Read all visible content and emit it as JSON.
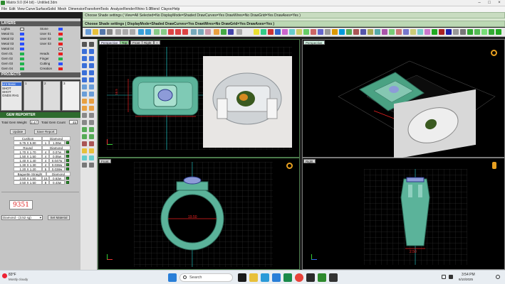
{
  "window": {
    "title": "Matrix 9.0 (64 bit) - Untitled.3dm"
  },
  "menu": [
    "File",
    "Edit",
    "View",
    "Curve",
    "Surface",
    "Solid",
    "Mesh",
    "Dimension",
    "Transform",
    "Tools",
    "Analyze",
    "Render",
    "Rhino 5.0",
    "Blend",
    "Clayoo",
    "Help"
  ],
  "command": {
    "line1": "Choose Shade settings ( View=All  Selected=No  DisplayMode=Shaded  DrawCurves=Yes  DrawWires=No  DrawGrid=Yes  DrawAxes=Yes )",
    "line2": "Choose Shade settings ( DisplayMode=Shaded  DrawCurves=Yes  DrawWires=No  DrawGrid=Yes  DrawAxes=Yes )"
  },
  "layers": {
    "header": "LAYERS",
    "rows": [
      {
        "name": "Lights",
        "color": "#ffffff"
      },
      {
        "name": "Metal 01",
        "color": "#2b4fff"
      },
      {
        "name": "Metal 02",
        "color": "#2b4fff"
      },
      {
        "name": "Metal 03",
        "color": "#2b4fff"
      },
      {
        "name": "Metal 04",
        "color": "#2b4fff"
      },
      {
        "name": "Gem 01",
        "color": "#21b34c"
      },
      {
        "name": "Gem 02",
        "color": "#21b34c"
      },
      {
        "name": "Gem 03",
        "color": "#21b34c"
      },
      {
        "name": "Gem 04",
        "color": "#21b34c"
      }
    ],
    "rows_right": [
      {
        "name": "Stone",
        "color": "#2b4fff"
      },
      {
        "name": "User 01",
        "color": "#e81f1f"
      },
      {
        "name": "User 02",
        "color": "#21b34c"
      },
      {
        "name": "User 03",
        "color": "#e81f1f"
      },
      {
        "name": "",
        "color": "#ffffff"
      },
      {
        "name": "Heads",
        "color": "#e81f1f"
      },
      {
        "name": "Finger",
        "color": "#21b34c"
      },
      {
        "name": "Cutting",
        "color": "#2b4fff"
      },
      {
        "name": "Creation",
        "color": "#e81f1f"
      }
    ]
  },
  "projects": {
    "header": "PROJECTS",
    "items": [
      "Unt Basic",
      "SHOT",
      "SHOT",
      "GNDS RH1"
    ],
    "cells": [
      "1",
      "2",
      "3",
      "4"
    ]
  },
  "gem_reporter": {
    "title": "GEM REPORTER",
    "total_weight_label": "Total Gem Weight",
    "total_weight_value": "2.47",
    "total_count_label": "Total Gem Count",
    "total_count_value": "45",
    "update_button": "Update",
    "save_report_button": "Save Report",
    "sections": [
      {
        "shape": "Cushion",
        "material": "Diamond",
        "rows": [
          {
            "size": "6.75 X 5.80",
            "qty": "1",
            "weight": "1.08w"
          }
        ]
      },
      {
        "shape": "Round",
        "material": "Diamond",
        "rows": [
          {
            "size": "1.70 X 1.70",
            "qty": "4",
            "weight": "0.07w"
          },
          {
            "size": "1.50 X 1.50",
            "qty": "4",
            "weight": "0.05w"
          },
          {
            "size": "1.40 X 1.40",
            "qty": "4",
            "weight": "0.047w"
          },
          {
            "size": "1.30 X 1.30",
            "qty": "4",
            "weight": "0.036w"
          },
          {
            "size": "1.20 X 1.20",
            "qty": "5",
            "weight": "0.038w"
          }
        ]
      },
      {
        "shape": "Baguette Straight",
        "material": "Diamond",
        "rows": [
          {
            "size": "2.50 X 1.50",
            "qty": "15",
            "weight": "0.63w"
          },
          {
            "size": "2.50 X 1.50",
            "qty": "8",
            "weight": "0.43w"
          }
        ]
      }
    ],
    "big_number": "9351",
    "material_select": "Diamond - (3.52 sg)",
    "set_material_button": "Set Material"
  },
  "viewports": {
    "top": {
      "tabs": [
        "Perspective",
        "Top",
        "Front",
        "Right"
      ],
      "active": "Top"
    },
    "perspective": {
      "label": "Perspective"
    },
    "front": {
      "label": "Front"
    },
    "right": {
      "label": "Right"
    },
    "dimension_top": "16.5",
    "dimension_front": "19.50",
    "dimension_right": "2.50"
  },
  "taskbar": {
    "weather_temp": "83°F",
    "weather_desc": "Mostly cloudy",
    "search_placeholder": "Search",
    "time": "3:54 PM",
    "date": "6/10/2025"
  }
}
